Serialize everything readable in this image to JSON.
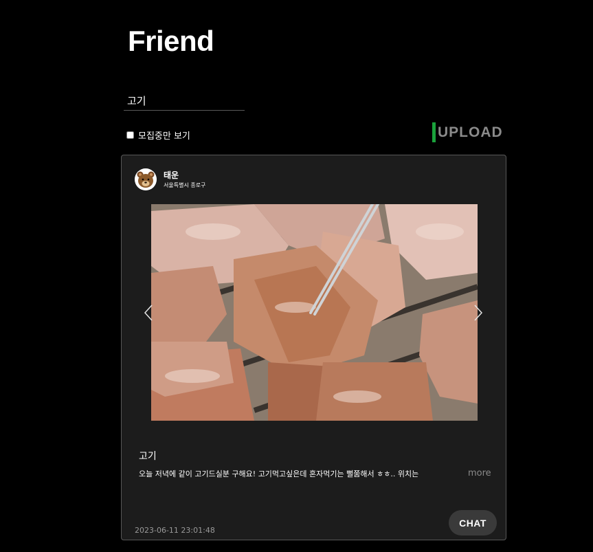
{
  "header": {
    "title": "Friend"
  },
  "search": {
    "value": "고기",
    "placeholder": ""
  },
  "filter": {
    "label": "모집중만 보기",
    "checked": false
  },
  "upload": {
    "label": "UPLOAD",
    "accent": "#1aa23b"
  },
  "post": {
    "author": {
      "name": "태운",
      "location": "서울특별시 종로구",
      "avatar_icon": "bear-avatar-icon"
    },
    "image": {
      "description_icon": "grilled-pork-photo"
    },
    "title": "고기",
    "body": "오늘 저녁에 같이 고기드실분 구해요! 고기먹고싶은데 혼자먹기는 뻘쭘해서 ㅎㅎ.. 위치는",
    "more_label": "more",
    "timestamp": "2023-06-11 23:01:48",
    "chat_label": "CHAT"
  },
  "colors": {
    "background": "#000000",
    "card": "#1c1c1c",
    "card_border": "#585858",
    "muted": "#8a8a8a"
  }
}
